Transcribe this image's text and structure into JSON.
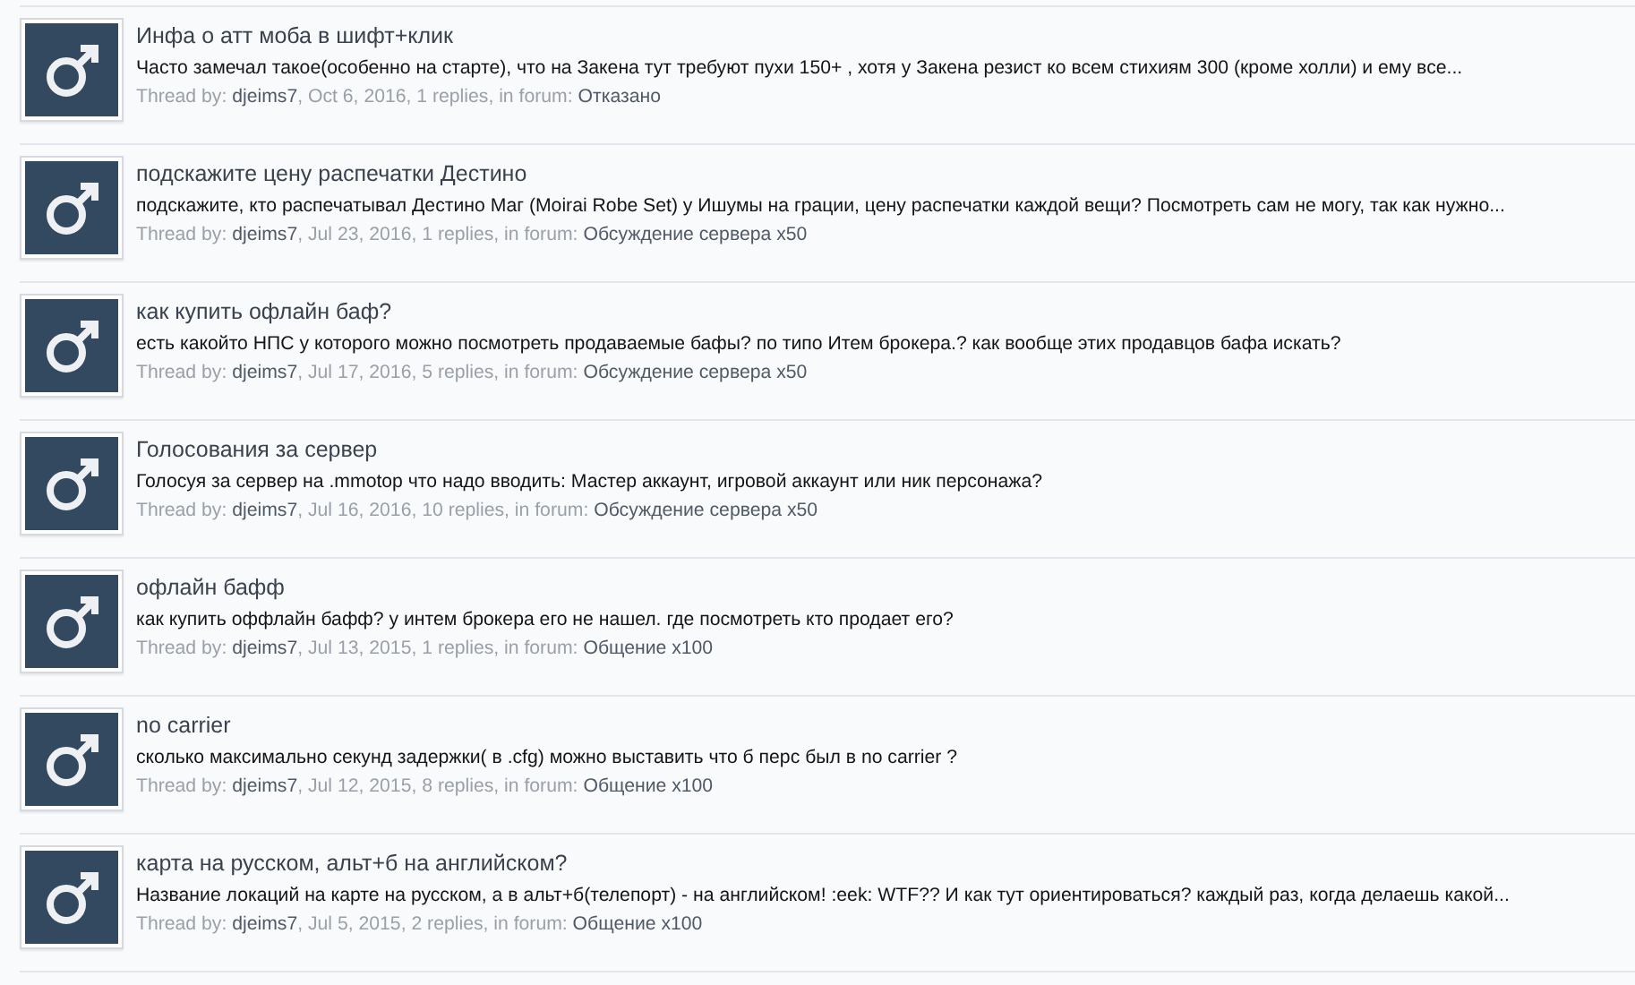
{
  "threads": [
    {
      "title": "Инфа о атт моба в шифт+клик",
      "snippet": "Часто замечал такое(особенно на старте), что на Закена тут требуют пухи 150+ , хотя у Закена резист ко всем стихиям 300 (кроме холли) и ему все...",
      "prefix": "Thread by:",
      "author": "djeims7",
      "details": ", Oct 6, 2016, 1 replies, in forum:",
      "forum": "Отказано"
    },
    {
      "title": "подскажите цену распечатки Дестино",
      "snippet": "подскажите, кто распечатывал Дестино Маг (Moirai Robe Set) у Ишумы на грации, цену распечатки каждой вещи? Посмотреть сам не могу, так как нужно...",
      "prefix": "Thread by:",
      "author": "djeims7",
      "details": ", Jul 23, 2016, 1 replies, in forum:",
      "forum": "Обсуждение сервера x50"
    },
    {
      "title": "как купить офлайн баф?",
      "snippet": "есть какойто НПС у которого можно посмотреть продаваемые бафы? по типо Итем брокера.? как вообще этих продавцов бафа искать?",
      "prefix": "Thread by:",
      "author": "djeims7",
      "details": ", Jul 17, 2016, 5 replies, in forum:",
      "forum": "Обсуждение сервера x50"
    },
    {
      "title": "Голосования за сервер",
      "snippet": "Голосуя за сервер на .mmotop что надо вводить: Мастер аккаунт, игровой аккаунт или ник персонажа?",
      "prefix": "Thread by:",
      "author": "djeims7",
      "details": ", Jul 16, 2016, 10 replies, in forum:",
      "forum": "Обсуждение сервера x50"
    },
    {
      "title": "офлайн бафф",
      "snippet": "как купить оффлайн бафф? у интем брокера его не нашел. где посмотреть кто продает его?",
      "prefix": "Thread by:",
      "author": "djeims7",
      "details": ", Jul 13, 2015, 1 replies, in forum:",
      "forum": "Общение x100"
    },
    {
      "title": "no carrier",
      "snippet": "сколько максимально секунд задержки( в .cfg) можно выставить что б перс был в no carrier ?",
      "prefix": "Thread by:",
      "author": "djeims7",
      "details": ", Jul 12, 2015, 8 replies, in forum:",
      "forum": "Общение x100"
    },
    {
      "title": "карта на русском, альт+б на английском?",
      "snippet": "Название локаций на карте на русском, а в альт+б(телепорт) - на английском! :eek: WTF?? И как тут ориентироваться? каждый раз, когда делаешь какой...",
      "prefix": "Thread by:",
      "author": "djeims7",
      "details": ", Jul 5, 2015, 2 replies, in forum:",
      "forum": "Общение x100"
    }
  ]
}
